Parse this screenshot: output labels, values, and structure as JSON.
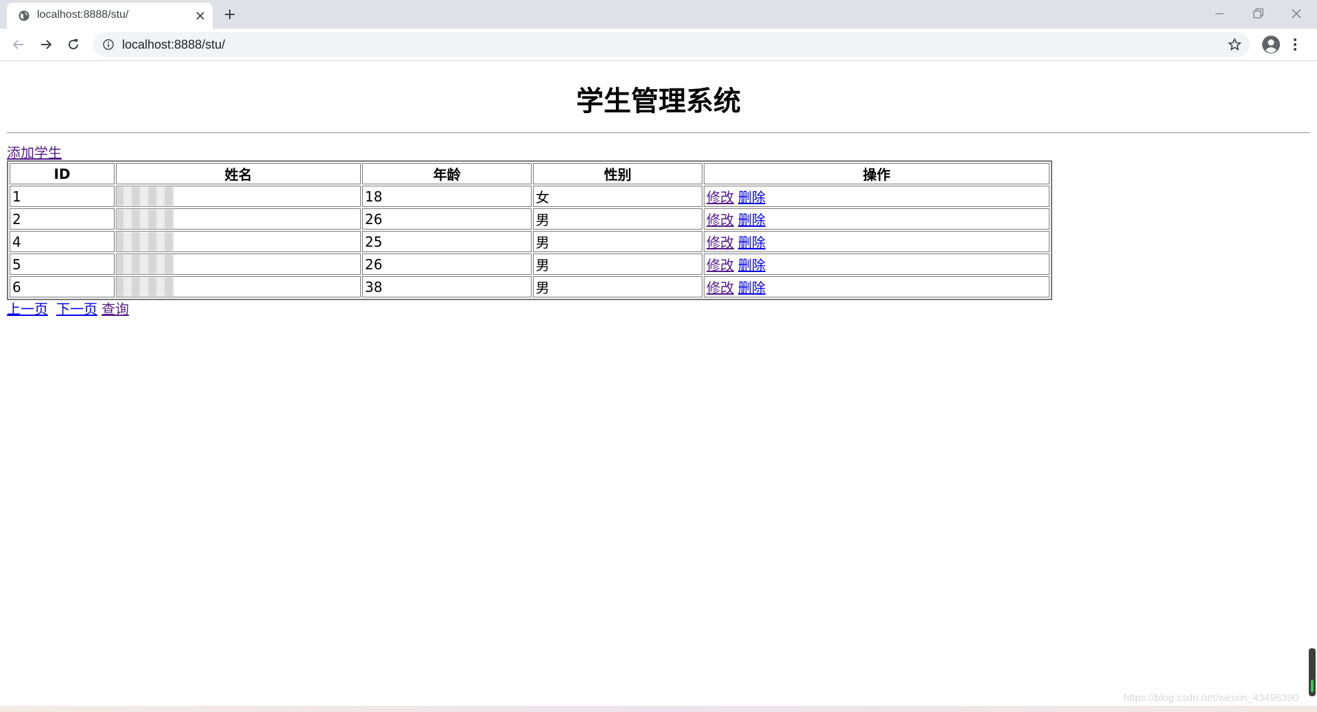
{
  "browser": {
    "tab_title": "localhost:8888/stu/",
    "url": "localhost:8888/stu/"
  },
  "page": {
    "title": "学生管理系统",
    "add_link": "添加学生",
    "table": {
      "headers": [
        "ID",
        "姓名",
        "年龄",
        "性别",
        "操作"
      ],
      "rows": [
        {
          "id": "1",
          "name": "",
          "age": "18",
          "gender": "女",
          "edit": "修改",
          "delete": "删除"
        },
        {
          "id": "2",
          "name": "",
          "age": "26",
          "gender": "男",
          "edit": "修改",
          "delete": "删除"
        },
        {
          "id": "4",
          "name": "",
          "age": "25",
          "gender": "男",
          "edit": "修改",
          "delete": "删除"
        },
        {
          "id": "5",
          "name": "",
          "age": "26",
          "gender": "男",
          "edit": "修改",
          "delete": "删除"
        },
        {
          "id": "6",
          "name": "",
          "age": "38",
          "gender": "男",
          "edit": "修改",
          "delete": "删除"
        }
      ]
    },
    "pager": {
      "prev": "上一页",
      "next": "下一页",
      "query": "查询"
    }
  },
  "watermark": "https://blog.csdn.net/weixin_43495390",
  "colors": {
    "visited_link": "#551a8b",
    "link": "#0000ee",
    "tabstrip": "#dee1e6",
    "omnibox": "#f1f3f4"
  },
  "icons": [
    "globe-icon",
    "close-icon",
    "plus-icon",
    "back-icon",
    "forward-icon",
    "reload-icon",
    "info-icon",
    "star-icon",
    "profile-icon",
    "menu-icon"
  ]
}
